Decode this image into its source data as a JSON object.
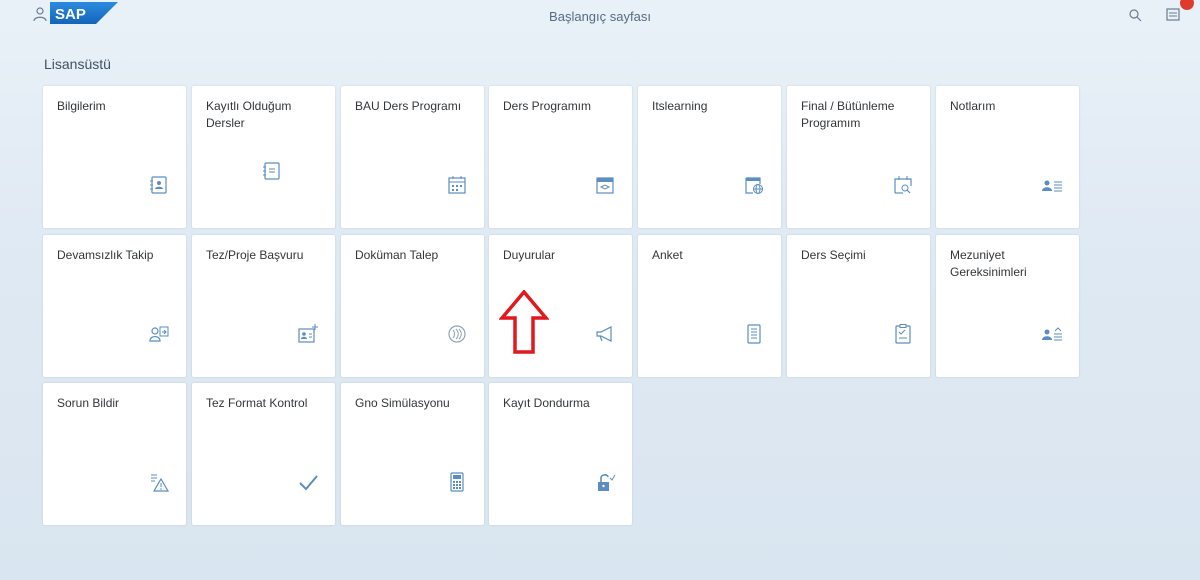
{
  "shell": {
    "logo_text": "SAP",
    "title": "Başlangıç sayfası"
  },
  "group": {
    "title": "Lisansüstü"
  },
  "tiles": [
    {
      "title": "Bilgilerim",
      "icon": "contact-card-icon"
    },
    {
      "title": "Kayıtlı Olduğum Dersler",
      "icon": "notebook-icon"
    },
    {
      "title": "BAU Ders Programı",
      "icon": "calendar-icon"
    },
    {
      "title": "Ders Programım",
      "icon": "course-calendar-icon"
    },
    {
      "title": "Itslearning",
      "icon": "web-window-icon"
    },
    {
      "title": "Final / Bütünleme Programım",
      "icon": "calendar-search-icon"
    },
    {
      "title": "Notlarım",
      "icon": "grades-icon"
    },
    {
      "title": "Devamsızlık Takip",
      "icon": "user-attendance-icon"
    },
    {
      "title": "Tez/Proje Başvuru",
      "icon": "document-add-icon"
    },
    {
      "title": "Doküman Talep",
      "icon": "document-request-icon"
    },
    {
      "title": "Duyurular",
      "icon": "megaphone-icon"
    },
    {
      "title": "Anket",
      "icon": "survey-icon"
    },
    {
      "title": "Ders Seçimi",
      "icon": "checklist-icon"
    },
    {
      "title": "Mezuniyet Gereksinimleri",
      "icon": "requirements-icon"
    },
    {
      "title": "Sorun Bildir",
      "icon": "warning-list-icon"
    },
    {
      "title": "Tez Format Kontrol",
      "icon": "checkmark-icon"
    },
    {
      "title": "Gno Simülasyonu",
      "icon": "calculator-icon"
    },
    {
      "title": "Kayıt Dondurma",
      "icon": "unlock-icon"
    }
  ],
  "colors": {
    "accent": "#5b8dc0",
    "annotation_arrow": "#e0191f",
    "tile_background": "#ffffff"
  }
}
